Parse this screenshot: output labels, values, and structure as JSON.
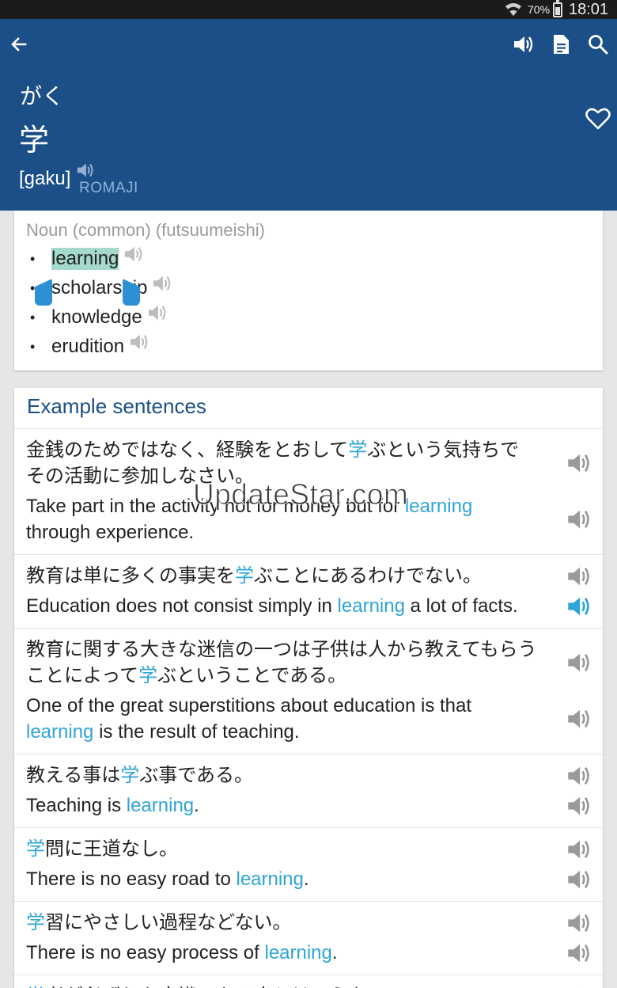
{
  "status_bar": {
    "battery_pct": "70%",
    "time": "18:01"
  },
  "header": {
    "back_icon": "arrow-left-icon",
    "icons": [
      "speaker-icon",
      "document-icon",
      "search-icon",
      "heart-outline-icon"
    ],
    "kana": "がく",
    "kanji": "学",
    "romaji": "[gaku]",
    "romaji_label": "ROMAJI",
    "colors": {
      "header_bg": "#1c4f88",
      "accent": "#2fa4d6",
      "selection": "#a5d9cc"
    }
  },
  "meanings": {
    "part_of_speech": "Noun (common) (futsuumeishi)",
    "items": [
      {
        "text": "learning",
        "selected": true
      },
      {
        "text": "scholarship",
        "selected": false
      },
      {
        "text": "knowledge",
        "selected": false
      },
      {
        "text": "erudition",
        "selected": false
      }
    ]
  },
  "examples": {
    "title": "Example sentences",
    "rows": [
      {
        "jp_lines": [
          [
            {
              "t": "金銭のためではなく、経験をとおして"
            },
            {
              "t": "学",
              "hl": true
            },
            {
              "t": "ぶという気持ちで"
            }
          ],
          [
            {
              "t": "その活動に参加しなさい。"
            }
          ]
        ],
        "en_lines": [
          [
            {
              "t": "Take part in the activity not for money but for "
            },
            {
              "t": "learning",
              "hl": true
            }
          ],
          [
            {
              "t": "through experience."
            }
          ]
        ]
      },
      {
        "jp_lines": [
          [
            {
              "t": "教育は単に多くの事実を"
            },
            {
              "t": "学",
              "hl": true
            },
            {
              "t": "ぶことにあるわけでない。"
            }
          ]
        ],
        "en_lines": [
          [
            {
              "t": "Education does not consist simply in "
            },
            {
              "t": "learning",
              "hl": true
            },
            {
              "t": " a lot of facts."
            }
          ]
        ],
        "en_speaker_active": true
      },
      {
        "jp_lines": [
          [
            {
              "t": "教育に関する大きな迷信の一つは子供は人から教えてもらう"
            }
          ],
          [
            {
              "t": "ことによって"
            },
            {
              "t": "学",
              "hl": true
            },
            {
              "t": "ぶということである。"
            }
          ]
        ],
        "en_lines": [
          [
            {
              "t": "One of the great superstitions about education is that"
            }
          ],
          [
            {
              "t": "learning",
              "hl": true
            },
            {
              "t": " is the result of teaching."
            }
          ]
        ]
      },
      {
        "jp_lines": [
          [
            {
              "t": "教える事は"
            },
            {
              "t": "学",
              "hl": true
            },
            {
              "t": "ぶ事である。"
            }
          ]
        ],
        "en_lines": [
          [
            {
              "t": "Teaching is "
            },
            {
              "t": "learning",
              "hl": true
            },
            {
              "t": "."
            }
          ]
        ]
      },
      {
        "jp_lines": [
          [
            {
              "t": "学",
              "hl": true
            },
            {
              "t": "問に王道なし。"
            }
          ]
        ],
        "en_lines": [
          [
            {
              "t": "There is no easy road to "
            },
            {
              "t": "learning",
              "hl": true
            },
            {
              "t": "."
            }
          ]
        ]
      },
      {
        "jp_lines": [
          [
            {
              "t": "学",
              "hl": true
            },
            {
              "t": "習にやさしい過程などない。"
            }
          ]
        ],
        "en_lines": [
          [
            {
              "t": "There is no easy process of "
            },
            {
              "t": "learning",
              "hl": true
            },
            {
              "t": "."
            }
          ]
        ]
      },
      {
        "jp_lines": [
          [
            {
              "t": "学",
              "hl": true
            },
            {
              "t": "者が必ずしも良識のある人とはいえない。"
            }
          ]
        ],
        "en_lines": []
      }
    ]
  },
  "watermark": "UpdateStar.com"
}
